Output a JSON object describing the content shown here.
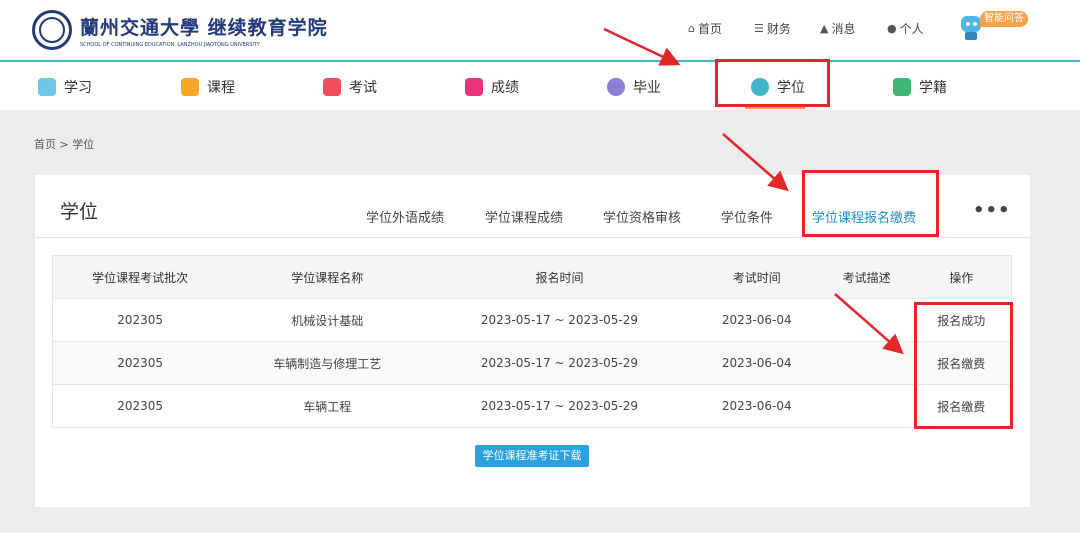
{
  "header": {
    "logo_cn": "蘭州交通大學 继续教育学院",
    "logo_en": "SCHOOL OF CONTINUING EDUCATION, LANZHOU JIAOTONG UNIVERSITY",
    "links": [
      {
        "icon": "home-icon",
        "label": "首页"
      },
      {
        "icon": "coins-icon",
        "label": "财务"
      },
      {
        "icon": "bell-icon",
        "label": "消息"
      },
      {
        "icon": "user-icon",
        "label": "个人"
      }
    ],
    "ai_badge": "智能问答"
  },
  "main_nav": [
    {
      "label": "学习",
      "icon": "study-icon",
      "color": "#6ec7e6"
    },
    {
      "label": "课程",
      "icon": "course-icon",
      "color": "#f5a623"
    },
    {
      "label": "考试",
      "icon": "exam-icon",
      "color": "#ef4f5a"
    },
    {
      "label": "成绩",
      "icon": "score-icon",
      "color": "#e8327e"
    },
    {
      "label": "毕业",
      "icon": "graduation-icon",
      "color": "#8e7fd6"
    },
    {
      "label": "学位",
      "icon": "degree-cap-icon",
      "color": "#3fb6c9",
      "active": true
    },
    {
      "label": "学籍",
      "icon": "status-list-icon",
      "color": "#3cb774"
    }
  ],
  "breadcrumb": "首页 > 学位",
  "card": {
    "title": "学位",
    "tabs": [
      "学位外语成绩",
      "学位课程成绩",
      "学位资格审核",
      "学位条件",
      "学位课程报名缴费"
    ],
    "active_tab": "学位课程报名缴费",
    "more": "•••"
  },
  "table": {
    "headers": [
      "学位课程考试批次",
      "学位课程名称",
      "报名时间",
      "考试时间",
      "考试描述",
      "操作"
    ],
    "rows": [
      {
        "batch": "202305",
        "name": "机械设计基础",
        "reg_time": "2023-05-17 ~ 2023-05-29",
        "exam_time": "2023-06-04",
        "desc": "",
        "op": "报名成功"
      },
      {
        "batch": "202305",
        "name": "车辆制造与修理工艺",
        "reg_time": "2023-05-17 ~ 2023-05-29",
        "exam_time": "2023-06-04",
        "desc": "",
        "op": "报名缴费"
      },
      {
        "batch": "202305",
        "name": "车辆工程",
        "reg_time": "2023-05-17 ~ 2023-05-29",
        "exam_time": "2023-06-04",
        "desc": "",
        "op": "报名缴费"
      }
    ]
  },
  "download_button": "学位课程准考证下载",
  "colors": {
    "accent": "#1f8fc9",
    "annotation_red": "#e4262b",
    "teal": "#40b8c4",
    "underline": "#f0a040"
  }
}
